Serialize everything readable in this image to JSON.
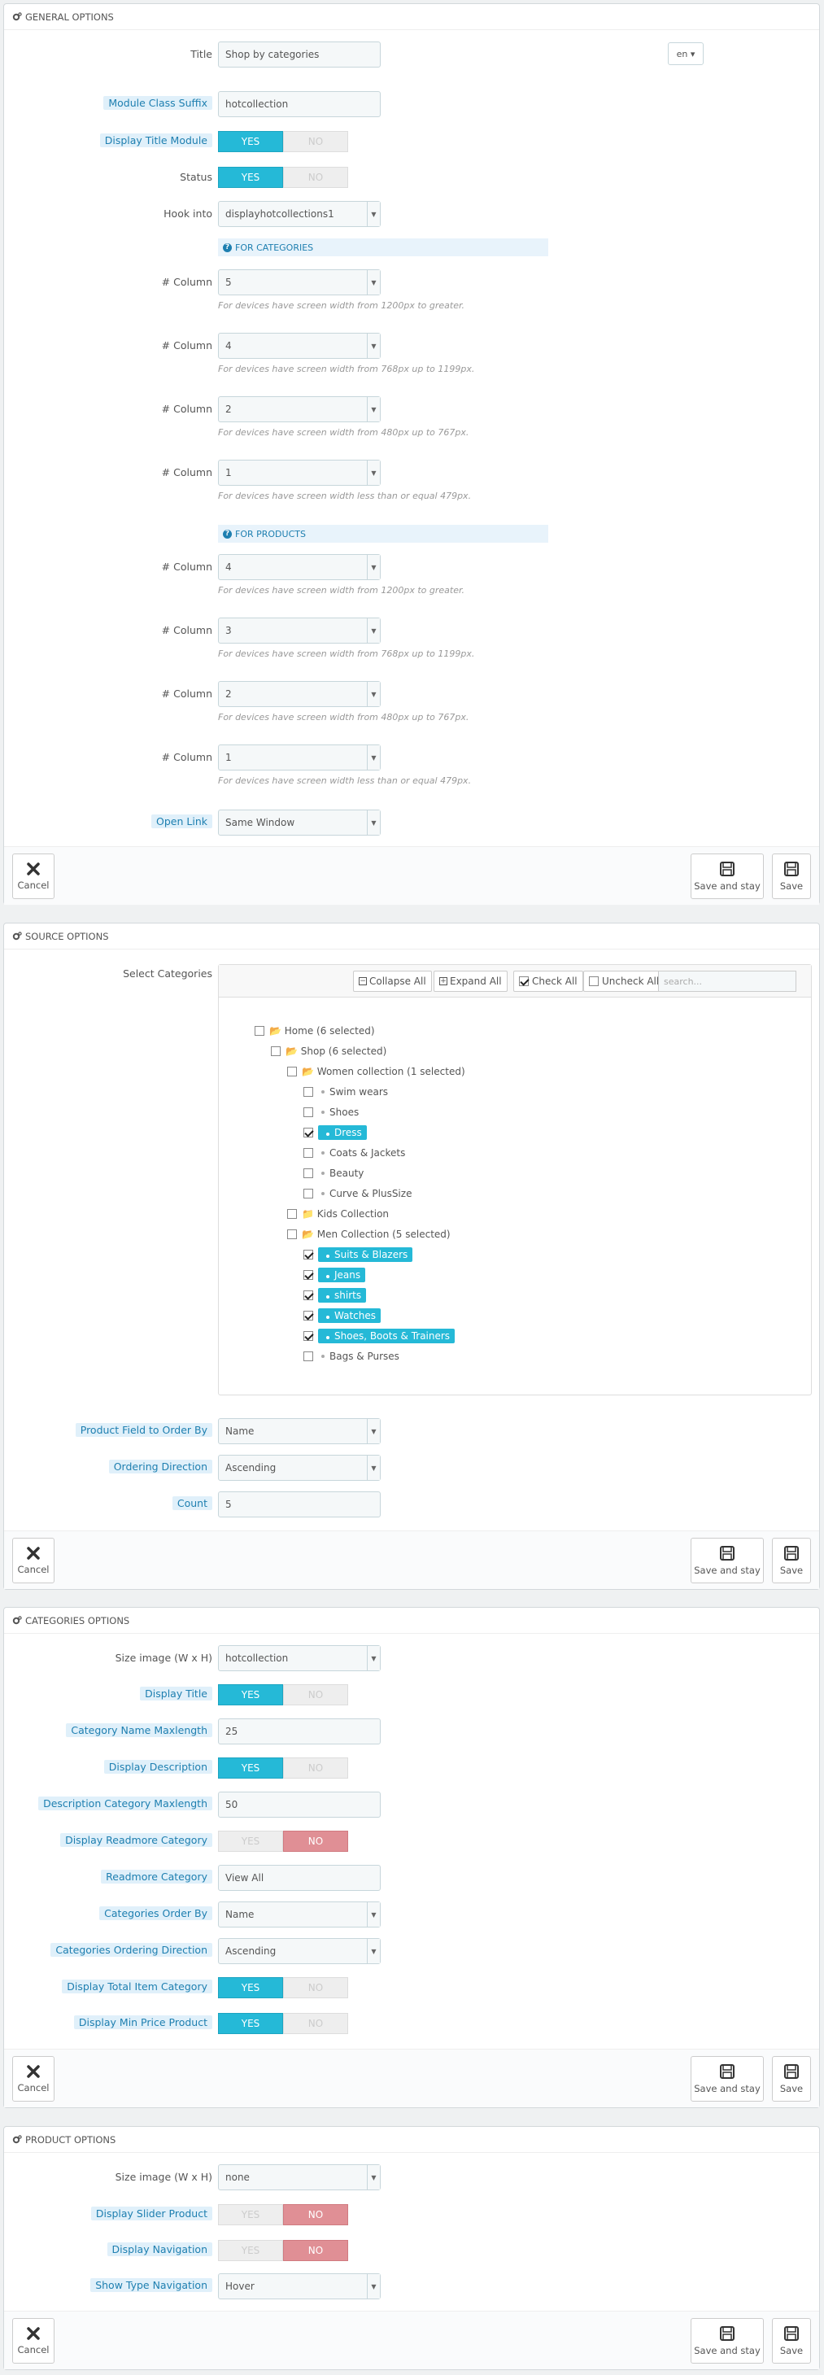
{
  "general": {
    "title": "GENERAL OPTIONS",
    "fields": {
      "title_label": "Title",
      "title_value": "Shop by categories",
      "lang": "en",
      "suffix_label": "Module Class Suffix",
      "suffix_value": "hotcollection",
      "display_title_label": "Display Title Module",
      "status_label": "Status",
      "hook_label": "Hook into",
      "hook_value": "displayhotcollections1",
      "for_categories": "FOR CATEGORIES",
      "for_products": "FOR PRODUCTS",
      "column_label": "# Column",
      "open_link_label": "Open Link",
      "open_link_value": "Same Window"
    },
    "cat_columns": [
      {
        "value": "5",
        "help": "For devices have screen width from 1200px to greater."
      },
      {
        "value": "4",
        "help": "For devices have screen width from 768px up to 1199px."
      },
      {
        "value": "2",
        "help": "For devices have screen width from 480px up to 767px."
      },
      {
        "value": "1",
        "help": "For devices have screen width less than or equal 479px."
      }
    ],
    "prod_columns": [
      {
        "value": "4",
        "help": "For devices have screen width from 1200px to greater."
      },
      {
        "value": "3",
        "help": "For devices have screen width from 768px up to 1199px."
      },
      {
        "value": "2",
        "help": "For devices have screen width from 480px up to 767px."
      },
      {
        "value": "1",
        "help": "For devices have screen width less than or equal 479px."
      }
    ]
  },
  "switch": {
    "yes": "YES",
    "no": "NO"
  },
  "buttons": {
    "cancel": "Cancel",
    "save_stay": "Save and stay",
    "save": "Save"
  },
  "source": {
    "title": "SOURCE OPTIONS",
    "select_label": "Select Categories",
    "collapse": "Collapse All",
    "expand": "Expand All",
    "check": "Check All",
    "uncheck": "Uncheck All",
    "search_placeholder": "search...",
    "tree": {
      "home": "Home (6 selected)",
      "shop": "Shop (6 selected)",
      "women": "Women collection (1 selected)",
      "swim": "Swim wears",
      "shoes": "Shoes",
      "dress": "Dress",
      "coats": "Coats & Jackets",
      "beauty": "Beauty",
      "curve": "Curve & PlusSize",
      "kids": "Kids Collection",
      "men": "Men Collection (5 selected)",
      "suits": "Suits & Blazers",
      "jeans": "Jeans",
      "shirts": "shirts",
      "watches": "Watches",
      "shoes_boots": "Shoes, Boots & Trainers",
      "bags": "Bags & Purses"
    },
    "order_by_label": "Product Field to Order By",
    "order_by_value": "Name",
    "direction_label": "Ordering Direction",
    "direction_value": "Ascending",
    "count_label": "Count",
    "count_value": "5"
  },
  "categories": {
    "title": "CATEGORIES OPTIONS",
    "size_label": "Size image (W x H)",
    "size_value": "hotcollection",
    "display_title_label": "Display Title",
    "maxlength_label": "Category Name Maxlength",
    "maxlength_value": "25",
    "display_desc_label": "Display Description",
    "desc_maxlength_label": "Description Category Maxlength",
    "desc_maxlength_value": "50",
    "readmore_display_label": "Display Readmore Category",
    "readmore_label": "Readmore Category",
    "readmore_value": "View All",
    "order_by_label": "Categories Order By",
    "order_by_value": "Name",
    "direction_label": "Categories Ordering Direction",
    "direction_value": "Ascending",
    "total_label": "Display Total Item Category",
    "min_price_label": "Display Min Price Product"
  },
  "product": {
    "title": "PRODUCT OPTIONS",
    "size_label": "Size image (W x H)",
    "size_value": "none",
    "slider_label": "Display Slider Product",
    "nav_label": "Display Navigation",
    "nav_type_label": "Show Type Navigation",
    "nav_type_value": "Hover"
  }
}
